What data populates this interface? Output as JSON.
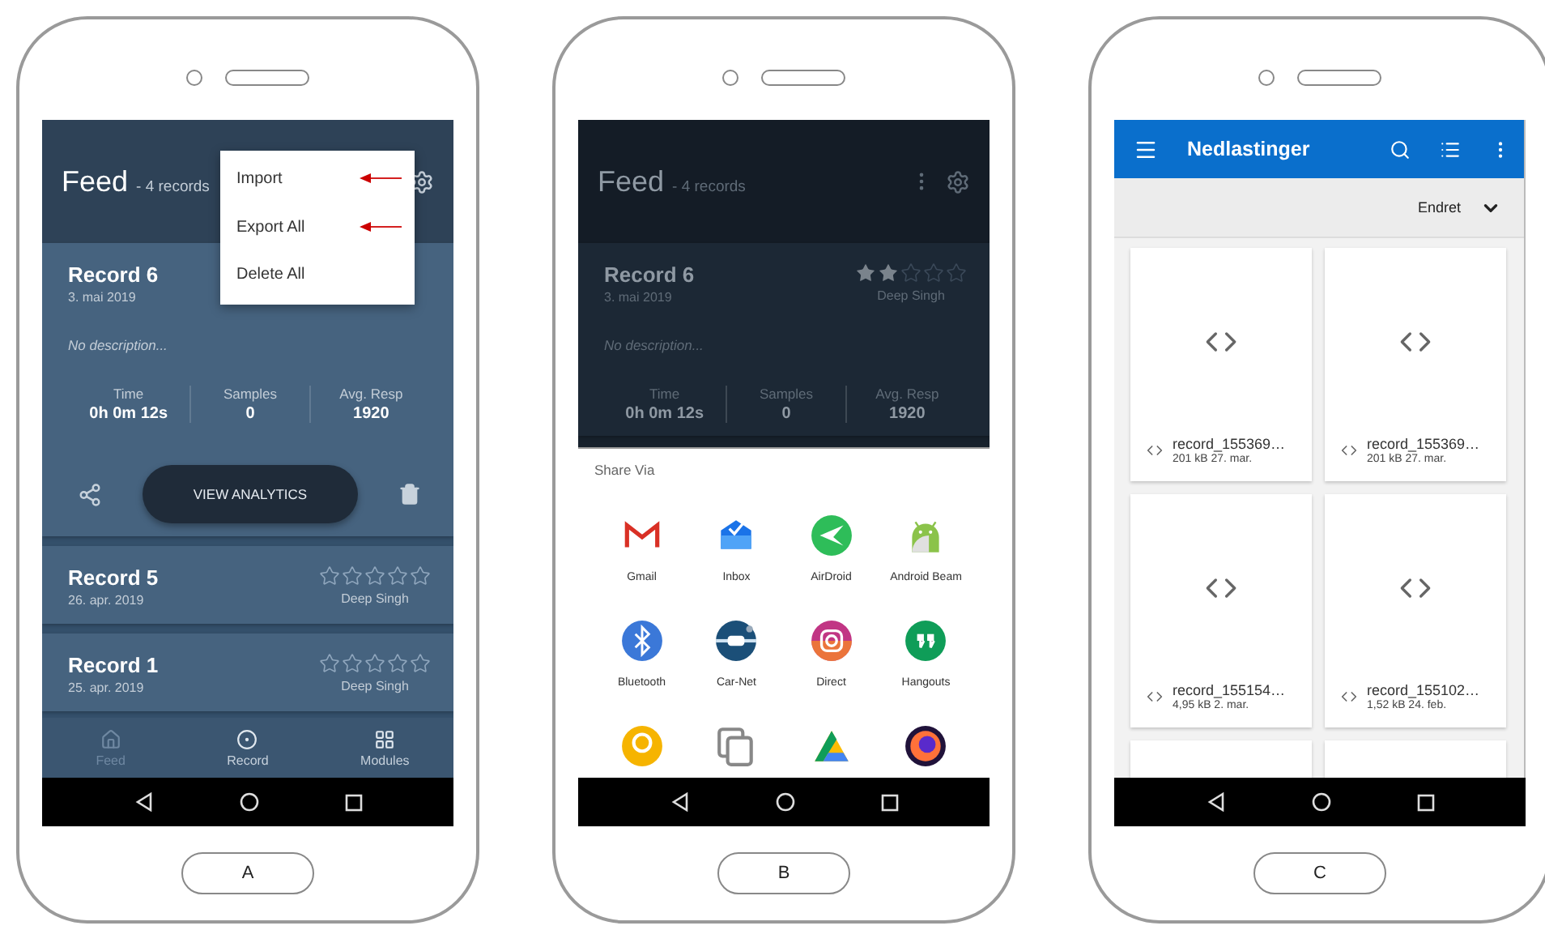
{
  "phones": [
    {
      "label": "A",
      "screen": {
        "kind": "feed",
        "dim": false,
        "title": "Feed",
        "subtitle": "- 4 records",
        "records": [
          {
            "name": "Record 6",
            "date": "3. mai 2019",
            "description": "No description...",
            "stats": [
              {
                "label": "Time",
                "value": "0h 0m 12s"
              },
              {
                "label": "Samples",
                "value": "0"
              },
              {
                "label": "Avg. Resp",
                "value": "1920"
              }
            ],
            "action": "VIEW ANALYTICS"
          },
          {
            "name": "Record 5",
            "date": "26. apr. 2019",
            "stars": 0,
            "author": "Deep Singh"
          },
          {
            "name": "Record 1",
            "date": "25. apr. 2019",
            "stars": 0,
            "author": "Deep Singh"
          }
        ],
        "menu": [
          {
            "label": "Import",
            "pointed": true
          },
          {
            "label": "Export All",
            "pointed": true
          },
          {
            "label": "Delete All",
            "pointed": false
          }
        ],
        "nav": [
          {
            "label": "Feed",
            "selected": true
          },
          {
            "label": "Record",
            "selected": false
          },
          {
            "label": "Modules",
            "selected": false
          }
        ]
      }
    },
    {
      "label": "B",
      "screen": {
        "kind": "share",
        "dim": true,
        "title": "Feed",
        "subtitle": "- 4 records",
        "records": [
          {
            "name": "Record 6",
            "date": "3. mai 2019",
            "stars": 2,
            "author": "Deep Singh",
            "description": "No description...",
            "stats": [
              {
                "label": "Time",
                "value": "0h 0m 12s"
              },
              {
                "label": "Samples",
                "value": "0"
              },
              {
                "label": "Avg. Resp",
                "value": "1920"
              }
            ]
          }
        ],
        "sheet_title": "Share Via",
        "apps": [
          {
            "kind": "app",
            "label": "Gmail"
          },
          {
            "kind": "app",
            "label": "Inbox"
          },
          {
            "kind": "app",
            "label": "AirDroid"
          },
          {
            "kind": "app",
            "label": "Android Beam"
          },
          {
            "kind": "app",
            "label": "Bluetooth"
          },
          {
            "kind": "app",
            "label": "Car-Net"
          },
          {
            "kind": "app",
            "label": "Direct"
          },
          {
            "kind": "app",
            "label": "Hangouts"
          },
          {
            "kind": "cut"
          },
          {
            "kind": "cut"
          },
          {
            "kind": "cut"
          },
          {
            "kind": "cut"
          }
        ]
      }
    },
    {
      "label": "C",
      "screen": {
        "kind": "files",
        "title": "Nedlastinger",
        "sort": "Endret",
        "files": [
          {
            "name": "record_155369…",
            "meta": "201 kB 27. mar."
          },
          {
            "name": "record_155369…",
            "meta": "201 kB 27. mar."
          },
          {
            "name": "record_155154…",
            "meta": "4,95 kB 2. mar."
          },
          {
            "name": "record_155102…",
            "meta": "1,52 kB 24. feb."
          }
        ]
      }
    }
  ]
}
